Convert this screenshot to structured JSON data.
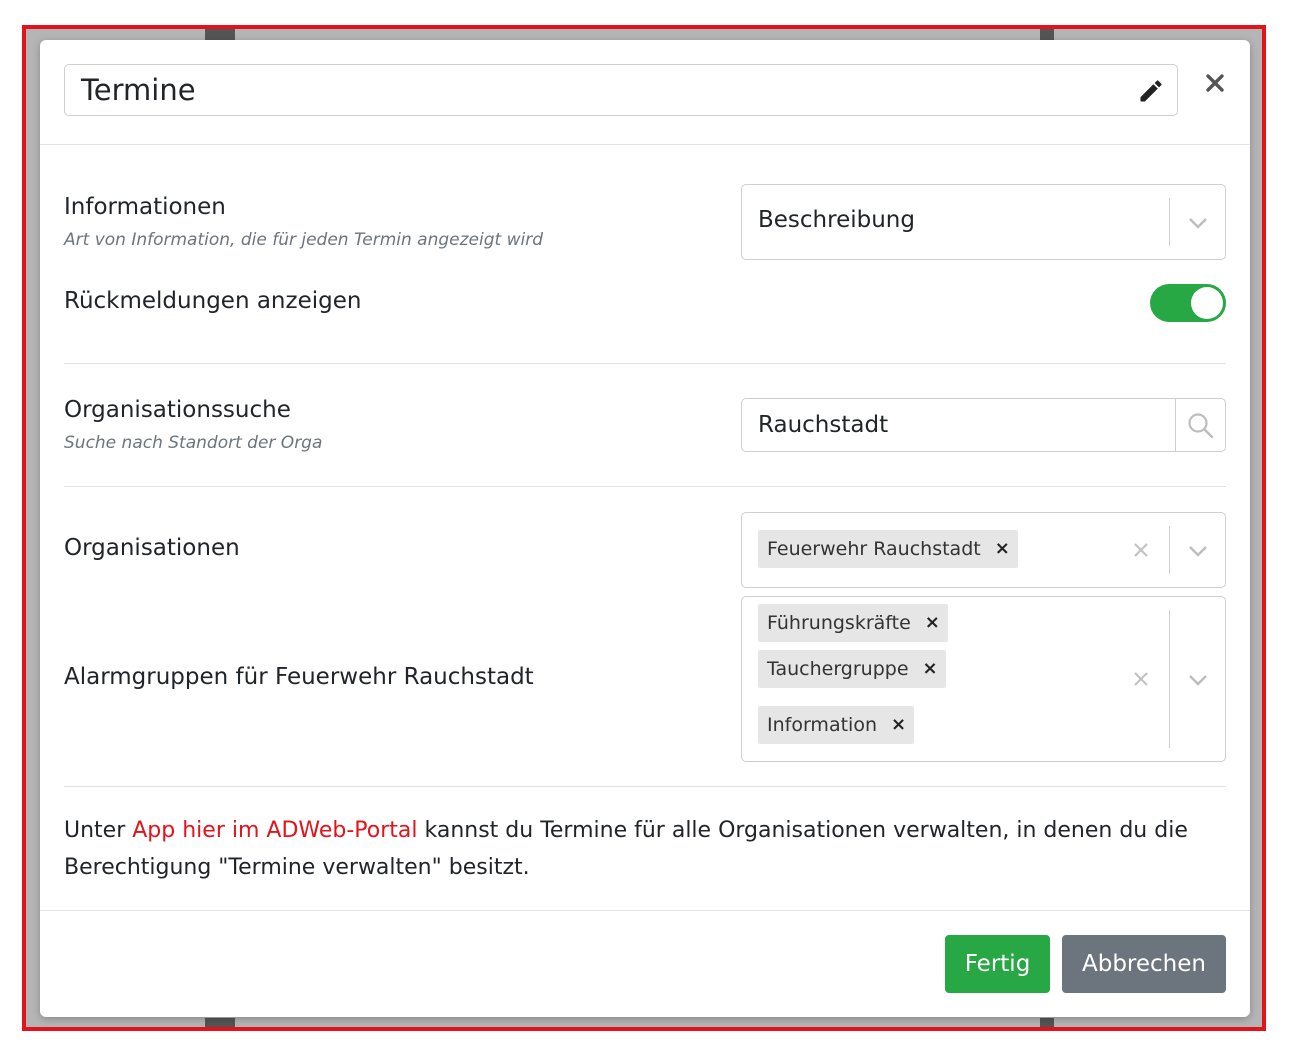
{
  "dialog": {
    "title_value": "Termine",
    "close_label": "×"
  },
  "information": {
    "label": "Informationen",
    "sublabel": "Art von Information, die für jeden Termin angezeigt wird",
    "selected": "Beschreibung"
  },
  "responses": {
    "label": "Rückmeldungen anzeigen",
    "enabled": true
  },
  "org_search": {
    "label": "Organisationssuche",
    "sublabel": "Suche nach Standort der Orga",
    "value": "Rauchstadt"
  },
  "organizations": {
    "label": "Organisationen",
    "selected": [
      "Feuerwehr Rauchstadt"
    ]
  },
  "alarm_groups": {
    "label": "Alarmgruppen für Feuerwehr Rauchstadt",
    "selected": [
      "Führungskräfte",
      "Tauchergruppe",
      "Information"
    ]
  },
  "info": {
    "prefix": "Unter ",
    "link": "App hier im ADWeb-Portal",
    "suffix": " kannst du Termine für alle Organisationen verwalten, in denen du die Berechtigung \"Termine verwalten\" besitzt."
  },
  "footer": {
    "done_label": "Fertig",
    "cancel_label": "Abbrechen"
  },
  "colors": {
    "accent_green": "#28a745",
    "secondary_gray": "#6c757d",
    "link_red": "#e3131b",
    "frame_red": "#e3131b"
  },
  "icons": {
    "title_edit": "pencil-icon",
    "dialog_close": "close-icon",
    "search": "search-icon",
    "dropdown": "chevron-down-icon",
    "clear": "clear-icon"
  }
}
